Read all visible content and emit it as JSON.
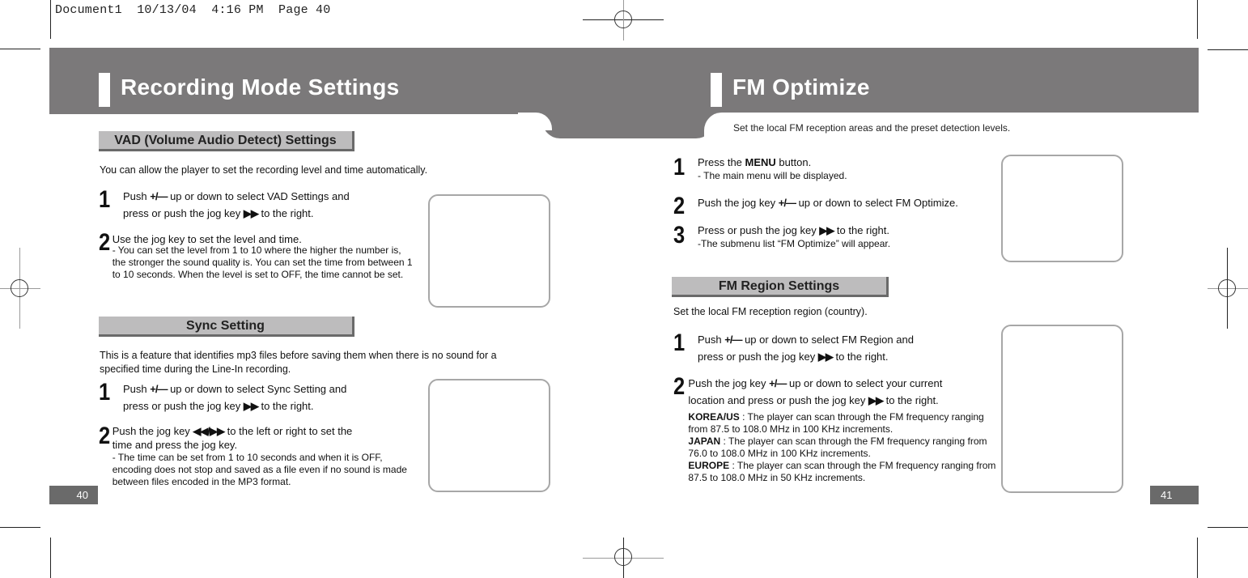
{
  "slug_line": "Document1  10/13/04  4:16 PM  Page 40",
  "left_page": {
    "title": "Recording Mode Settings",
    "page_number": "40",
    "sections": [
      {
        "heading": "VAD (Volume Audio Detect) Settings",
        "lead": "You can allow the player to set the recording level and time automatically.",
        "steps": [
          {
            "num": "1",
            "line1_pre": "Push ",
            "glyph1": "+/—",
            "line1_post": " up or down to select VAD Settings and",
            "line2_pre": "press or push the jog key ",
            "glyph2": "▶▶",
            "line2_post": " to the right."
          },
          {
            "num": "2",
            "text": "Use the jog key to set the level and time.",
            "note": "- You can set the level from 1 to 10 where the higher the number is, the stronger the sound quality is. You can set the time from between 1 to 10 seconds. When the level is set to OFF, the time cannot be set."
          }
        ]
      },
      {
        "heading": "Sync Setting",
        "lead": "This is a feature that identifies mp3 files before saving them when there is no sound for a specified time during the Line-In recording.",
        "steps": [
          {
            "num": "1",
            "line1_pre": "Push ",
            "glyph1": "+/—",
            "line1_post": " up or down to select Sync Setting and",
            "line2_pre": "press or push the jog key ",
            "glyph2": "▶▶",
            "line2_post": " to the right."
          },
          {
            "num": "2",
            "line1_pre": "Push the jog key ",
            "glyph1": "◀◀/▶▶",
            "line1_post": " to the left or right to set the",
            "line2": "time and press the jog key.",
            "note": "- The time can be set from 1 to 10 seconds and when it is OFF, encoding does not stop and saved as a file even if no sound is made between files encoded in the MP3 format."
          }
        ]
      }
    ]
  },
  "right_page": {
    "title": "FM Optimize",
    "intro": "Set the local FM reception areas and the preset detection levels.",
    "page_number": "41",
    "steps": [
      {
        "num": "1",
        "pre": "Press the ",
        "bold": "MENU",
        "post": " button.",
        "note": "- The main menu will be displayed."
      },
      {
        "num": "2",
        "pre": "Push the jog key ",
        "glyph": "+/—",
        "post": " up or down to select FM Optimize."
      },
      {
        "num": "3",
        "pre": "Press or push the jog key ",
        "glyph": "▶▶",
        "post": " to the right.",
        "note": "-The submenu list “FM Optimize” will appear."
      }
    ],
    "region": {
      "heading": "FM Region Settings",
      "lead": "Set the local FM reception region (country).",
      "steps": [
        {
          "num": "1",
          "line1_pre": "Push ",
          "glyph1": "+/—",
          "line1_post": " up or down to select FM Region and",
          "line2_pre": "press or push the jog key ",
          "glyph2": "▶▶",
          "line2_post": " to the right."
        },
        {
          "num": "2",
          "line1_pre": "Push the jog key ",
          "glyph1": "+/—",
          "line1_post": " up or down to select your current",
          "line2_pre": "location and press or push the jog key ",
          "glyph2": "▶▶",
          "line2_post": " to the right."
        }
      ],
      "regions": [
        {
          "name": "KOREA/US",
          "desc": " : The player can scan through the FM frequency ranging from 87.5 to 108.0 MHz in 100 KHz increments."
        },
        {
          "name": "JAPAN",
          "desc": " : The player can scan through the FM frequency ranging from 76.0 to 108.0 MHz in 100 KHz increments."
        },
        {
          "name": "EUROPE",
          "desc": " : The player can scan through the FM frequency ranging from 87.5 to 108.0 MHz in 50 KHz increments."
        }
      ]
    }
  },
  "colors": {
    "banner": "#7b797a",
    "section_head": "#bdbcbd",
    "page_tab": "#6a6a6a"
  }
}
